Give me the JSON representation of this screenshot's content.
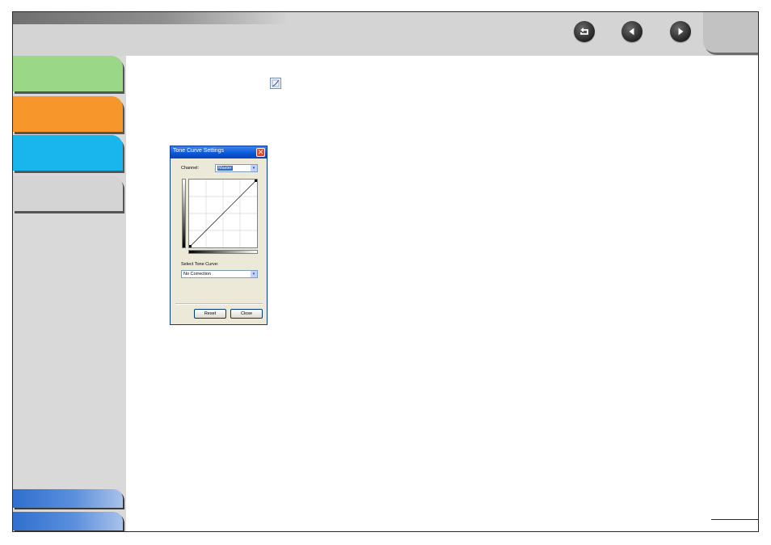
{
  "colors": {
    "header_bg": "#d4d4d4",
    "sidebar_bg": "#d9d9d9",
    "tab_green": "#9ad887",
    "tab_orange": "#f7962a",
    "tab_cyan": "#18b6ec",
    "tab_gray": "#d4d4d4",
    "tab_blue": "#4a86d8"
  },
  "header": {
    "icons": [
      "back-return-icon",
      "previous-page-icon",
      "next-page-icon"
    ]
  },
  "dialog": {
    "title": "Tone Curve Settings",
    "close_glyph": "✕",
    "channel_label": "Channel:",
    "channel_value": "Master",
    "select_tone_curve_label": "Select Tone Curve:",
    "tone_curve_value": "No Correction",
    "dropdown_arrow": "▾",
    "reset_button": "Reset",
    "close_button": "Close"
  }
}
